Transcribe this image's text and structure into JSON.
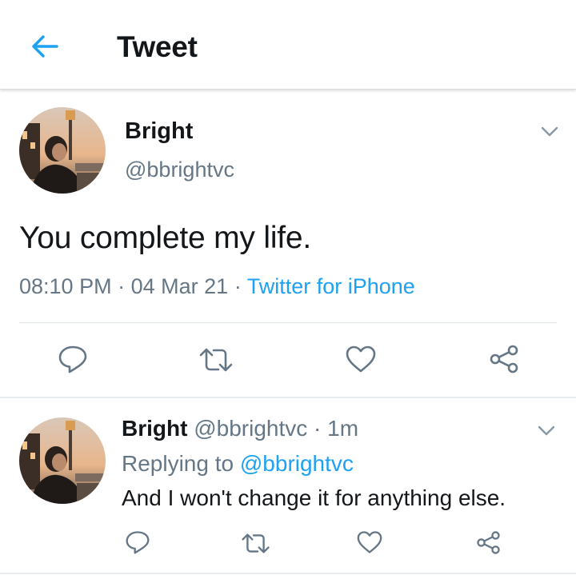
{
  "header": {
    "title": "Tweet",
    "back_icon": "arrow-left-icon"
  },
  "colors": {
    "accent": "#1da1f2",
    "secondary_text": "#657786",
    "primary_text": "#14171a",
    "divider": "#e1e8ed"
  },
  "tweet": {
    "name": "Bright",
    "handle": "@bbrightvc",
    "text": "You complete my life.",
    "time": "08:10 PM",
    "date": "04 Mar 21",
    "separator": "·",
    "source": "Twitter for iPhone",
    "actions": [
      "reply-icon",
      "retweet-icon",
      "like-icon",
      "share-icon"
    ]
  },
  "reply": {
    "name": "Bright",
    "handle": "@bbrightvc",
    "separator": "·",
    "age": "1m",
    "replying_label": "Replying to",
    "replying_to": "@bbrightvc",
    "text": "And I won't change it for anything else.",
    "actions": [
      "reply-icon",
      "retweet-icon",
      "like-icon",
      "share-icon"
    ]
  }
}
